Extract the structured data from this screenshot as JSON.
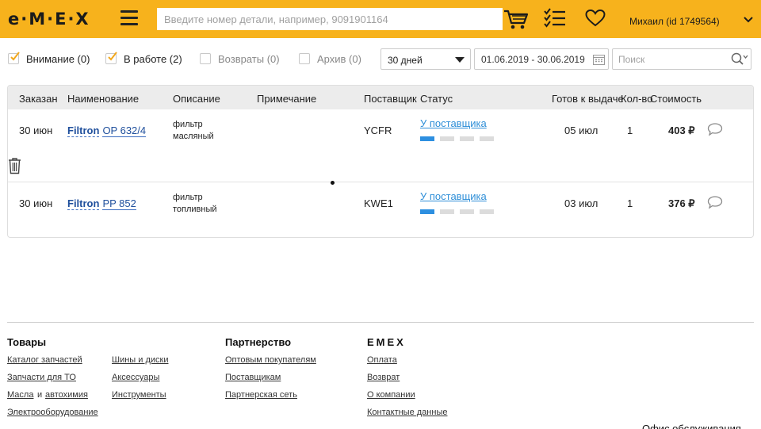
{
  "header": {
    "logo": "e·M·E·X",
    "search_placeholder": "Введите номер детали, например, 9091901164",
    "user": "Михаил  (id 1749564)"
  },
  "filters": {
    "attention": "Внимание (0)",
    "in_work": "В работе (2)",
    "returns": "Возвраты (0)",
    "archive": "Архив (0)",
    "period": "30 дней",
    "date_range": "01.06.2019 - 30.06.2019",
    "search_placeholder": "Поиск"
  },
  "table": {
    "columns": {
      "ordered": "Заказан",
      "name": "Наименование",
      "description": "Описание",
      "note": "Примечание",
      "supplier": "Поставщик",
      "status": "Статус",
      "ready": "Готов к выдаче",
      "qty": "Кол-во",
      "cost": "Стоимость"
    },
    "rows": [
      {
        "ordered": "30 июн",
        "brand": "Filtron",
        "part": "OP 632/4",
        "desc1": "фильтр",
        "desc2": "масляный",
        "supplier": "YCFR",
        "status": "У поставщика",
        "progress_step": 1,
        "progress_total": 4,
        "ready": "05 июл",
        "qty": "1",
        "cost": "403 ₽"
      },
      {
        "ordered": "30 июн",
        "brand": "Filtron",
        "part": "PP 852",
        "desc1": "фильтр",
        "desc2": "топливный",
        "supplier": "KWE1",
        "status": "У поставщика",
        "progress_step": 1,
        "progress_total": 4,
        "ready": "03 июл",
        "qty": "1",
        "cost": "376 ₽"
      }
    ]
  },
  "footer": {
    "goods": {
      "title": "Товары",
      "catalog": "Каталог запчастей",
      "tires": "Шины и диски",
      "to_parts": "Запчасти для ТО",
      "accessories": "Аксессуары",
      "oils": "Масла",
      "and": "и",
      "autochem": "автохимия",
      "tools": "Инструменты",
      "electro": "Электрооборудование"
    },
    "partnership": {
      "title": "Партнерство",
      "wholesale": "Оптовым покупателям",
      "suppliers": "Поставщикам",
      "network": "Партнерская сеть"
    },
    "emex": {
      "title": "EMEX",
      "payment": "Оплата",
      "returns": "Возврат",
      "about": "О компании",
      "contacts": "Контактные данные"
    },
    "office_cut": "Офис обслуживания"
  }
}
